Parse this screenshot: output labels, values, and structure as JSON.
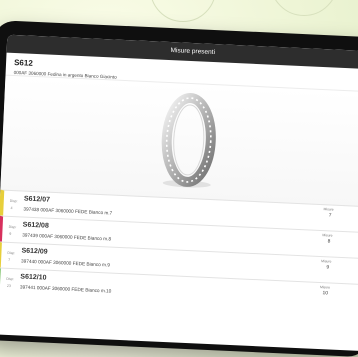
{
  "modal": {
    "title": "Misure presenti",
    "close_icon": "close-icon",
    "product_code": "S612",
    "product_desc": "000AF 3060000 Fedina in argento Bianco Giacinto"
  },
  "product_image": {
    "icon": "ring-icon"
  },
  "rows": [
    {
      "code": "S612/07",
      "sku_label": "Disp:",
      "sku_value": "4",
      "article": "397438 000AF 3060000 FEDE Bianco m.7",
      "misure_label": "Misure",
      "misure_value": "7",
      "accent": "#e7cf3b"
    },
    {
      "code": "S612/08",
      "sku_label": "Disp:",
      "sku_value": "9",
      "article": "397439 000AF 3060000 FEDE Bianco m.8",
      "misure_label": "Misure",
      "misure_value": "8",
      "accent": "#d7305d"
    },
    {
      "code": "S612/09",
      "sku_label": "Disp:",
      "sku_value": "7",
      "article": "397440 000AF 3060000 FEDE Bianco m.9",
      "misure_label": "Misure",
      "misure_value": "9",
      "accent": "#e7cf3b"
    },
    {
      "code": "S612/10",
      "sku_label": "Disp:",
      "sku_value": "23",
      "article": "397441 000AF 3060000 FEDE Bianco m.10",
      "misure_label": "Misure",
      "misure_value": "10",
      "accent": "#62b34a"
    }
  ]
}
